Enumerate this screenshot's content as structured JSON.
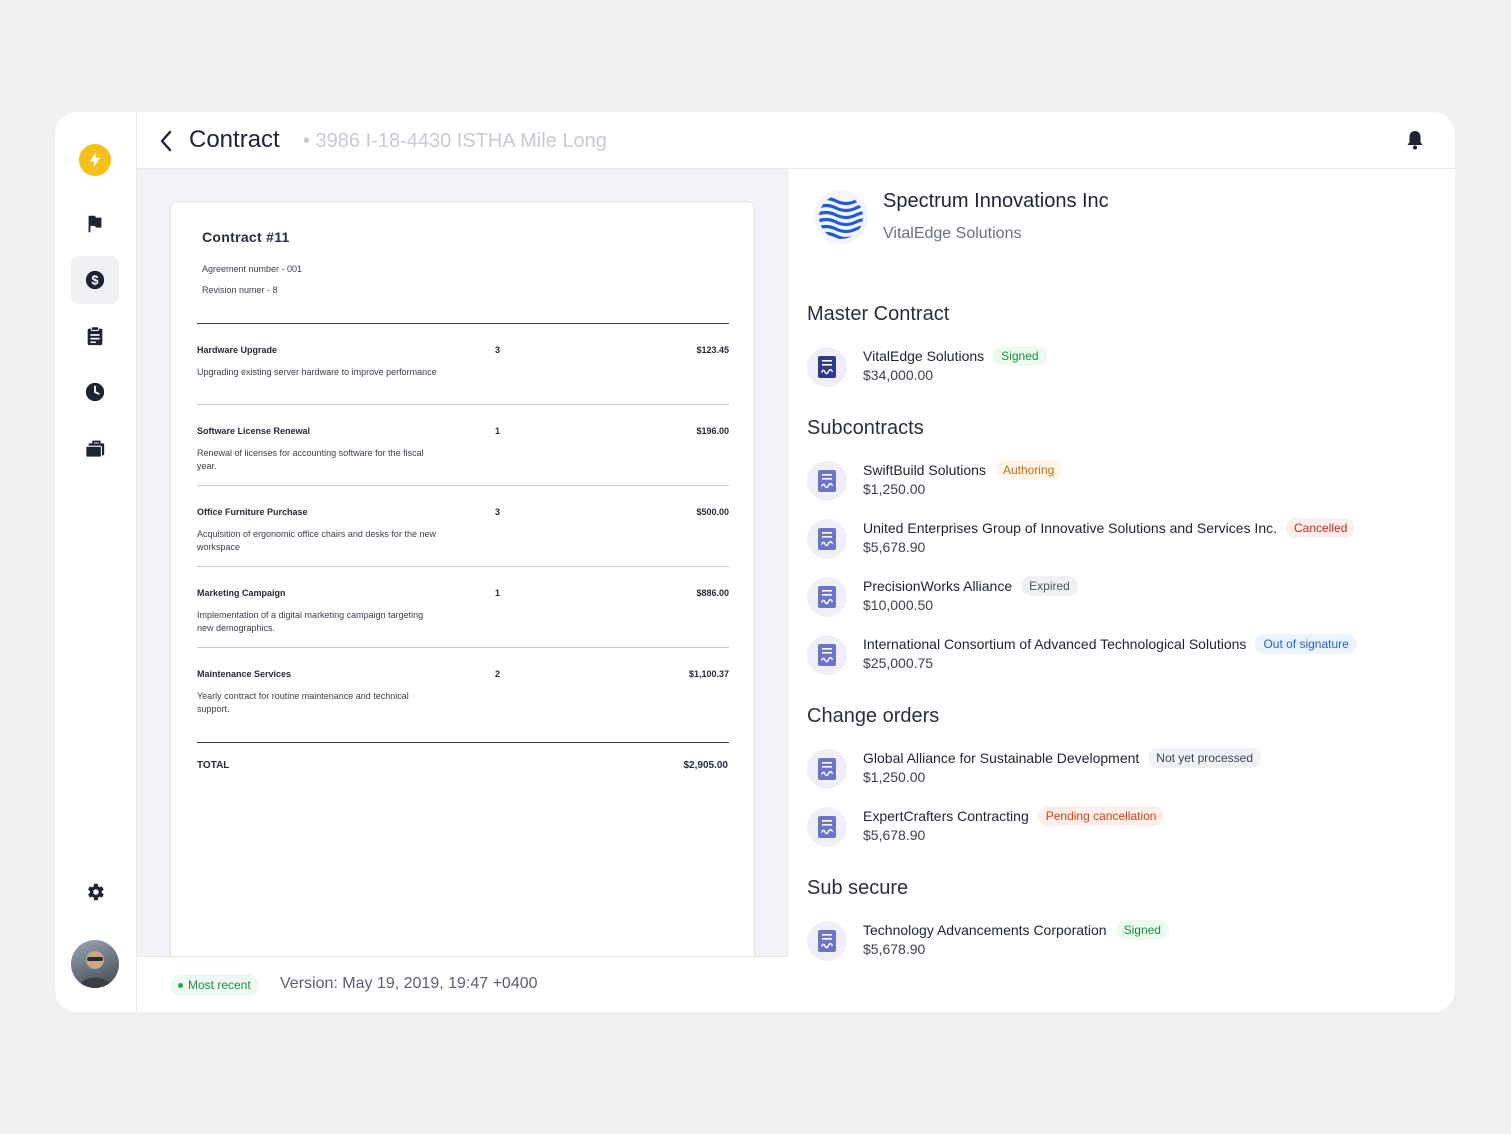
{
  "header": {
    "title": "Contract",
    "subtitle": "• 3986 I-18-4430 ISTHA Mile Long"
  },
  "document": {
    "title": "Contract #11",
    "agreement": "Agreement number - 001",
    "revision": "Revision numer - 8",
    "items": [
      {
        "name": "Hardware Upgrade",
        "desc": "Upgrading existing server hardware to improve performance",
        "qty": "3",
        "price": "$123.45"
      },
      {
        "name": "Software License Renewal",
        "desc": "Renewal of licenses for accounting software for the fiscal year.",
        "qty": "1",
        "price": "$196.00"
      },
      {
        "name": "Office Furniture Purchase",
        "desc": "Acquisition of ergonomic office chairs and desks for the new workspace",
        "qty": "3",
        "price": "$500.00"
      },
      {
        "name": "Marketing Campaign",
        "desc": "Implementation of a digital marketing campaign targeting new demographics.",
        "qty": "1",
        "price": "$886.00"
      },
      {
        "name": "Maintenance Services",
        "desc": "Yearly contract for routine maintenance and technical support.",
        "qty": "2",
        "price": "$1,100.37"
      }
    ],
    "total_label": "TOTAL",
    "total_value": "$2,905.00"
  },
  "footer": {
    "badge": "Most recent",
    "version": "Version: May 19, 2019, 19:47 +0400"
  },
  "company": {
    "name": "Spectrum Innovations Inc",
    "sub": "VitalEdge Solutions"
  },
  "sections": {
    "master": {
      "title": "Master Contract",
      "items": [
        {
          "name": "VitalEdge Solutions",
          "status": "Signed",
          "amount": "$34,000.00"
        }
      ]
    },
    "subcontracts": {
      "title": "Subcontracts",
      "items": [
        {
          "name": "SwiftBuild Solutions",
          "status": "Authoring",
          "amount": " $1,250.00"
        },
        {
          "name": "United Enterprises Group of Innovative Solutions and Services Inc.",
          "status": "Cancelled",
          "amount": "$5,678.90"
        },
        {
          "name": "PrecisionWorks Alliance",
          "status": "Expired",
          "amount": "$10,000.50"
        },
        {
          "name": "International Consortium of Advanced Technological Solutions",
          "status": "Out of signature",
          "amount": "$25,000.75"
        }
      ]
    },
    "change_orders": {
      "title": "Change orders",
      "items": [
        {
          "name": "Global Alliance for Sustainable Development",
          "status": "Not yet processed",
          "amount": " $1,250.00"
        },
        {
          "name": "ExpertCrafters Contracting",
          "status": "Pending cancellation",
          "amount": "$5,678.90"
        }
      ]
    },
    "sub_secure": {
      "title": "Sub secure",
      "items": [
        {
          "name": "Technology Advancements Corporation",
          "status": "Signed",
          "amount": "$5,678.90"
        }
      ]
    }
  },
  "colors": {
    "logo": "#f8c01a",
    "sidebar_icon": "#1f2433",
    "doc_icon_master": "#2e3a8c",
    "doc_icon": "#6b74c6"
  }
}
